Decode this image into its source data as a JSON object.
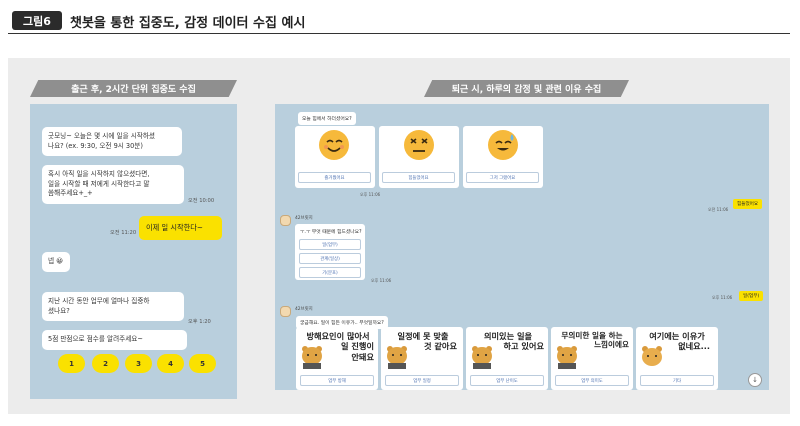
{
  "figure": {
    "badge": "그림6",
    "title": "챗봇을 통한 집중도, 감정 데이터 수집 예시"
  },
  "left_panel": {
    "title": "출근 후, 2시간 단위 집중도 수집",
    "messages": [
      {
        "line1": "굿모닝~ 오늘은 몇 시에 일을 시작하셨",
        "line2": "나요? (ex. 9:30, 오전 9시 30분)"
      },
      {
        "line1": "혹시 아직 일을 시작하지 않으셨다면,",
        "line2": "일을 시작할 때 저에게 시작한다고 말",
        "line3": "씀해주세요+_+",
        "time": "오전 10:00"
      },
      {
        "reply": "이제 일 시작한다~",
        "time": "오전 11:20"
      },
      {
        "text": "넵 😀"
      },
      {
        "line1": "지난 시간 동안 업무에 얼마나 집중하",
        "line2": "셨나요?",
        "time": "오후 1:20"
      },
      {
        "text": "5점 만점으로 점수를 알려주세요~"
      }
    ],
    "score_buttons": [
      "1",
      "2",
      "3",
      "4",
      "5"
    ]
  },
  "right_panel": {
    "title": "퇴근 시, 하루의 감정 및 관련 이유 수집",
    "q1": "오늘 힘에서 하더셨어요?",
    "mood_options": [
      "즐거웠어요",
      "힘들었어요",
      "그저 그랬어요"
    ],
    "time1": "오후 11:06",
    "reply1_time": "오전 11:06",
    "reply1": "힘들었어요",
    "bot_name": "42브릿지",
    "q2": "ㅜ.ㅜ 무엇 때문에 힘드셨나요?",
    "reason_options": [
      "일(업무)",
      "관계(일상)",
      "기(분포)"
    ],
    "time2": "오후 11:06",
    "reply2_time": "오후 11:06",
    "reply2": "일(업무)",
    "bot_name2": "42브릿지",
    "q3": "궁금해요. 일이 힘든 이유가.. 무엇일까요?",
    "reason_cards": [
      {
        "text1": "방해요인이 많아서",
        "text2": "일 진행이",
        "text3": "안돼요",
        "button": "업무 방해"
      },
      {
        "text1": "일정에 못 맞출",
        "text2": "것 같아요",
        "text3": "",
        "button": "업무 일정"
      },
      {
        "text1": "의미있는 일을",
        "text2": "하고 있어요",
        "text3": "",
        "button": "업무 난이도"
      },
      {
        "text1": "무의미한 일을 하는",
        "text2": "느낌이에요",
        "text3": "",
        "button": "업무 의미도"
      },
      {
        "text1": "여기에는 이유가",
        "text2": "없네요...",
        "text3": "",
        "button": "기타"
      }
    ],
    "scroll_label": "↓"
  },
  "colors": {
    "chat_bg": "#b9cfdd",
    "kakao_yellow": "#fae100",
    "title_bar": "#8f8f8f",
    "badge": "#2b2b2b"
  }
}
